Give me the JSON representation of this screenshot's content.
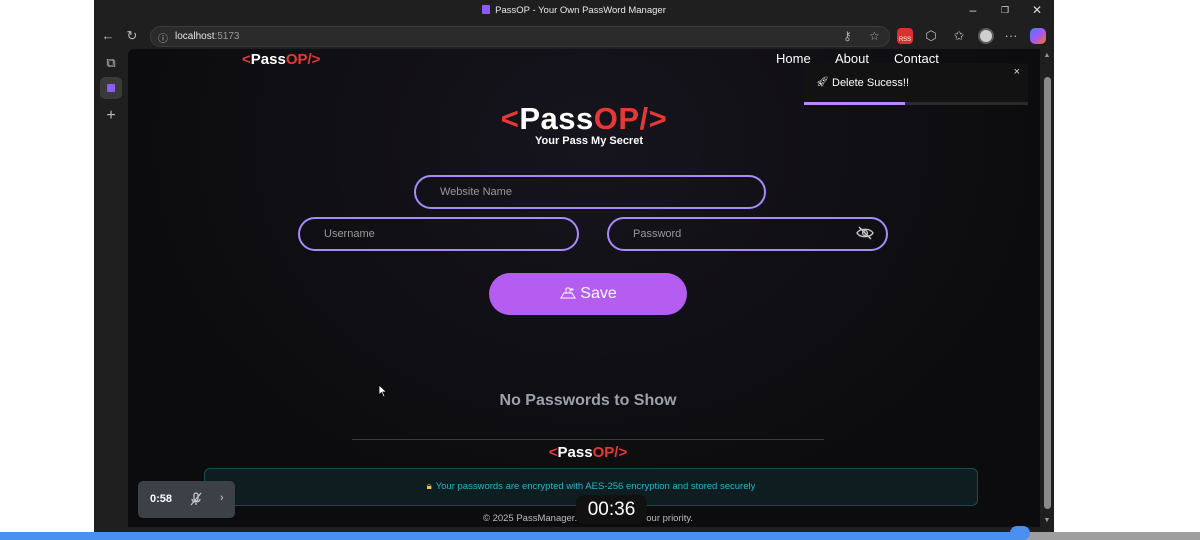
{
  "window": {
    "title": "PassOP - Your Own PassWord Manager",
    "url_host": "localhost",
    "url_port": ":5173",
    "ext_badge": "RSS"
  },
  "site": {
    "brand_lt": "<",
    "brand_pass": "Pass",
    "brand_op": "OP",
    "brand_gt": "/>",
    "nav": [
      "Home",
      "About",
      "Contact"
    ],
    "tagline": "Your Pass My Secret"
  },
  "form": {
    "website_placeholder": "Website Name",
    "username_placeholder": "Username",
    "password_placeholder": "Password",
    "save_label": "Save"
  },
  "empty_state": "No Passwords to Show",
  "footer": {
    "encryption_note": "Your passwords are encrypted with AES-256 encryption and stored securely",
    "copyright": "© 2025 PassManager. Your security is our priority."
  },
  "toast": {
    "message": "Delete Sucess!!",
    "close": "×",
    "progress_fraction": 0.45
  },
  "video": {
    "timecode": "0:58",
    "elapsed": "00:36",
    "progress_fraction": 0.85
  },
  "colors": {
    "accent_purple": "#b55df0",
    "brand_red": "#e53935",
    "field_border": "#a78bfa",
    "info_cyan": "#29b6c9"
  },
  "icons": {
    "eye_toggle": "eye-off-icon",
    "save": "lock-plus-icon",
    "toast": "rocket-icon",
    "encryption": "lock-icon"
  }
}
